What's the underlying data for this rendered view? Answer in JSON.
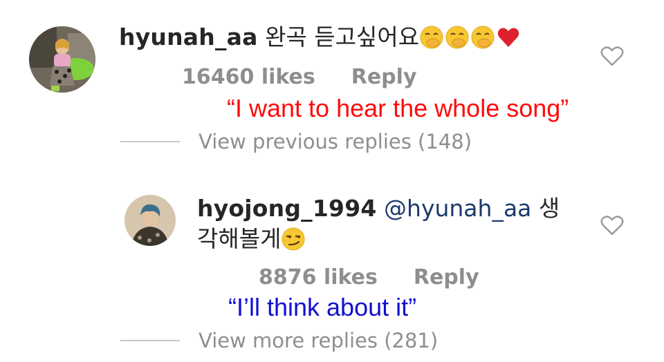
{
  "comment1": {
    "username": "hyunah_aa",
    "text": "완곡 듣고싶어요",
    "emojis": [
      "face-with-hand-over-mouth",
      "face-with-hand-over-mouth",
      "face-with-hand-over-mouth",
      "red-heart"
    ],
    "likes": "16460 likes",
    "reply_label": "Reply",
    "translation": "“I want to hear the whole song”",
    "view_replies": "View previous replies (148)"
  },
  "comment2": {
    "username": "hyojong_1994",
    "mention": "@hyunah_aa",
    "text_line1": "생",
    "text_line2": "각해볼게",
    "emoji": "smirking-face",
    "likes": "8876 likes",
    "reply_label": "Reply",
    "translation": "“I’ll think about it”",
    "view_replies": "View more replies (281)"
  },
  "colors": {
    "text": "#262626",
    "meta": "#8e8e8e",
    "mention": "#1c3a6b",
    "translation_red": "#ff0a0a",
    "translation_blue": "#1010d0"
  }
}
